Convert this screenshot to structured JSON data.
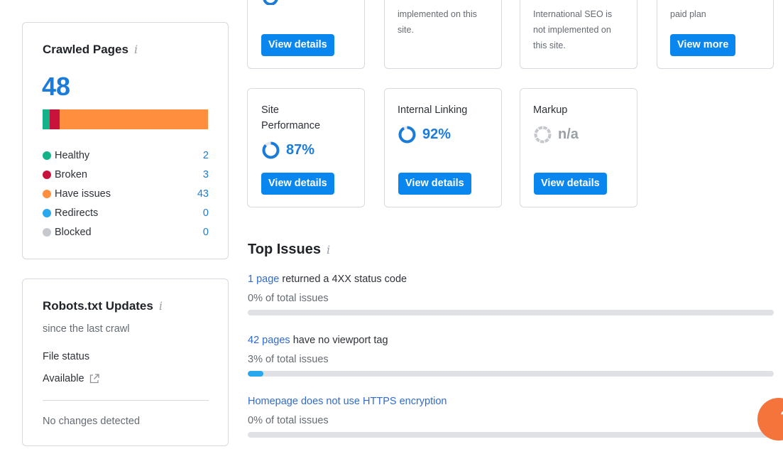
{
  "top_cards": [
    {
      "button": "View details"
    },
    {
      "text": "implemented on this\nsite."
    },
    {
      "text": "International SEO is\nnot implemented on\nthis site."
    },
    {
      "text": "paid plan",
      "button": "View more"
    }
  ],
  "score_cards": [
    {
      "label": "Site\nPerformance",
      "value": "87%",
      "percent": 87,
      "button": "View details"
    },
    {
      "label": "Internal Linking",
      "value": "92%",
      "percent": 92,
      "button": "View details"
    },
    {
      "label": "Markup",
      "value": "n/a",
      "percent": 0,
      "button": "View details"
    }
  ],
  "crawled": {
    "title": "Crawled Pages",
    "total": "48",
    "rows": [
      {
        "label": "Healthy",
        "value": 2,
        "color": "#13b38a"
      },
      {
        "label": "Broken",
        "value": 3,
        "color": "#c8143c"
      },
      {
        "label": "Have issues",
        "value": 43,
        "color": "#ff8f3f"
      },
      {
        "label": "Redirects",
        "value": 0,
        "color": "#2aa8ee"
      },
      {
        "label": "Blocked",
        "value": 0,
        "color": "#c5c8cd"
      }
    ]
  },
  "robots": {
    "title": "Robots.txt Updates",
    "subtitle": "since the last crawl",
    "file_status_label": "File status",
    "file_status_value": "Available",
    "changes": "No changes detected"
  },
  "top_issues": {
    "title": "Top Issues",
    "items": [
      {
        "link": "1 page",
        "rest": " returned a 4XX status code",
        "pct": "0% of total issues",
        "fill": 0
      },
      {
        "link": "42 pages",
        "rest": " have no viewport tag",
        "pct": "3% of total issues",
        "fill": 3
      },
      {
        "link": "Homepage does not use HTTPS encryption",
        "rest": "",
        "pct": "0% of total issues",
        "fill": 0
      }
    ]
  },
  "help": {
    "label": "?"
  },
  "colors": {
    "accent": "#0a86ef",
    "score_blue": "#1a7bd8",
    "na_gray": "#c5c8cd",
    "help_orange": "#f4743b"
  }
}
